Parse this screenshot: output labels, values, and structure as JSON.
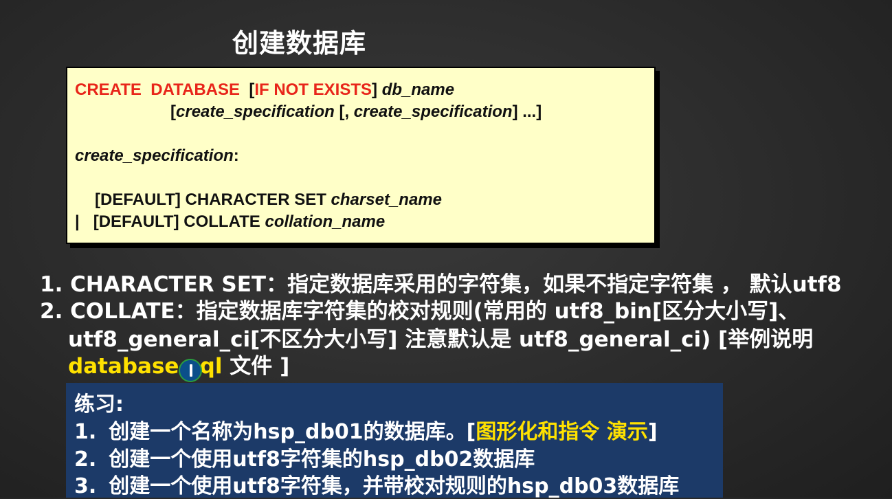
{
  "title": "创建数据库",
  "syntax": {
    "l1_create": "CREATE  DATABASE",
    "l1_open": "  [",
    "l1_if": "IF NOT EXISTS",
    "l1_close": "] ",
    "l1_dbname": "db_name",
    "l2_open": "[",
    "l2_spec1": "create_specification",
    "l2_mid": " [, ",
    "l2_spec2": "create_specification",
    "l2_end": "] ...]",
    "l3_spec": "create_specification",
    "l3_colon": ":",
    "l4_text": "[DEFAULT] CHARACTER SET ",
    "l4_var": "charset_name",
    "l5_pipe": "|",
    "l5_text": "[DEFAULT] COLLATE ",
    "l5_var": "collation_name"
  },
  "notes": {
    "line1": "1. CHARACTER SET：指定数据库采用的字符集，如果不指定字符集 ， 默认utf8",
    "line2": "2. COLLATE：指定数据库字符集的校对规则(常用的 utf8_bin[区分大小写]、",
    "line3": "utf8_general_ci[不区分大小写] 注意默认是 utf8_general_ci) [举例说明",
    "line4_file": "database.sql",
    "line4_rest": " 文件 ]"
  },
  "practice": {
    "heading": "练习:",
    "item1_num": "1.",
    "item1_text": "创建一个名称为hsp_db01的数据库。[",
    "item1_highlight": "图形化和指令 演示",
    "item1_end": "]",
    "item2_num": "2.",
    "item2_text": "创建一个使用utf8字符集的hsp_db02数据库",
    "item3_num": "3.",
    "item3_text": "创建一个使用utf8字符集，并带校对规则的hsp_db03数据库"
  },
  "colors": {
    "syntax_bg": "#ffffc8",
    "keyword_red": "#e8251a",
    "highlight_yellow": "#ffe100",
    "practice_bg": "#1c3a68"
  },
  "icons": {
    "cursor": "text-cursor-icon"
  }
}
